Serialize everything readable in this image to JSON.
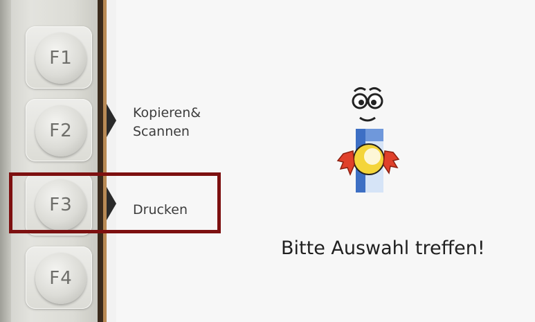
{
  "function_keys": [
    {
      "label": "F1"
    },
    {
      "label": "F2"
    },
    {
      "label": "F3"
    },
    {
      "label": "F4"
    }
  ],
  "menu": {
    "copy_scan_line1": "Kopieren&",
    "copy_scan_line2": "Scannen",
    "print": "Drucken"
  },
  "prompt": "Bitte Auswahl treffen!",
  "highlight": {
    "target": "F3",
    "color": "#7d1010"
  },
  "icons": [
    "mascot-icon",
    "softkey-arrow-icon"
  ]
}
